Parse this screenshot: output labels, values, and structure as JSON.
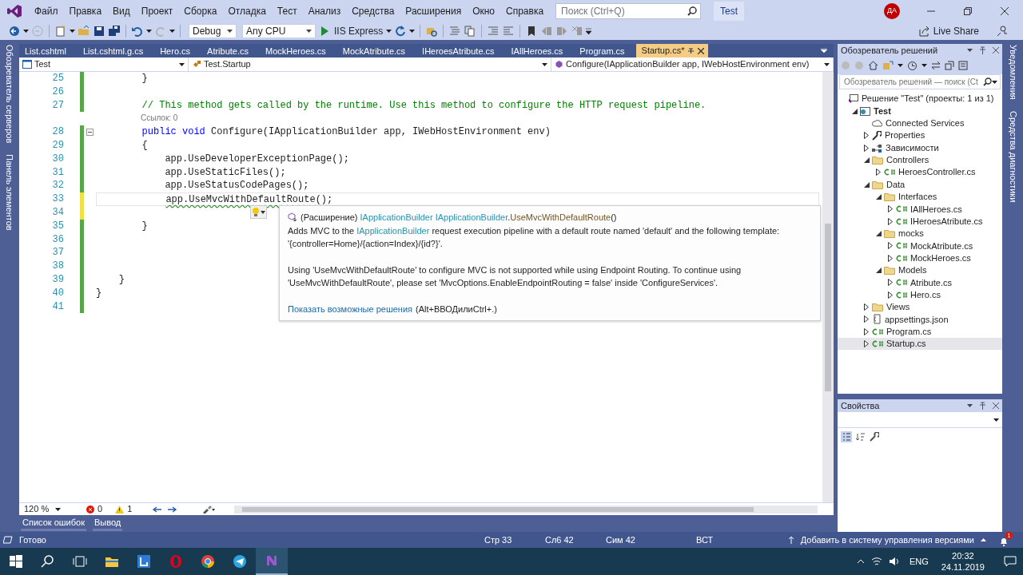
{
  "menu": [
    "Файл",
    "Правка",
    "Вид",
    "Проект",
    "Сборка",
    "Отладка",
    "Тест",
    "Анализ",
    "Средства",
    "Расширения",
    "Окно",
    "Справка"
  ],
  "search": {
    "placeholder": "Поиск (Ctrl+Q)"
  },
  "solution_badge": "Test",
  "avatar": "ДА",
  "toolbar": {
    "configuration": "Debug",
    "platform": "Any CPU",
    "run_target": "IIS Express",
    "live_share": "Live Share"
  },
  "side_left": [
    "Обозреватель серверов",
    "Панель элементов"
  ],
  "side_right": [
    "Уведомления",
    "Средства диагностики"
  ],
  "tabs": [
    {
      "label": "List.cshtml",
      "selected": false
    },
    {
      "label": "List.cshtml.g.cs",
      "selected": false
    },
    {
      "label": "Hero.cs",
      "selected": false
    },
    {
      "label": "Atribute.cs",
      "selected": false
    },
    {
      "label": "MockHeroes.cs",
      "selected": false
    },
    {
      "label": "MockAtribute.cs",
      "selected": false
    },
    {
      "label": "IHeroesAtribute.cs",
      "selected": false
    },
    {
      "label": "IAllHeroes.cs",
      "selected": false
    },
    {
      "label": "Program.cs",
      "selected": false
    },
    {
      "label": "Startup.cs*",
      "selected": true
    }
  ],
  "nav_bar": {
    "project": "Test",
    "class": "Test.Startup",
    "member": "Configure(IApplicationBuilder app, IWebHostEnvironment env)"
  },
  "code": {
    "lines": [
      {
        "kind": "code",
        "number": "25",
        "saved": true,
        "current": false,
        "tokens": [
          {
            "text": "        }",
            "kind": "plain"
          }
        ]
      },
      {
        "kind": "code",
        "number": "26",
        "saved": true,
        "current": false
      },
      {
        "kind": "code",
        "number": "27",
        "saved": true,
        "current": false,
        "tokens": [
          {
            "text": "        // This method gets called by the runtime. Use this method to configure the HTTP request pipeline.",
            "kind": "comment"
          }
        ]
      },
      {
        "kind": "codelens",
        "text": "Ссылок: 0"
      },
      {
        "kind": "code",
        "number": "28",
        "saved": true,
        "current": false,
        "expanded": true,
        "tokens": [
          {
            "text": "        public void",
            "kind": "keyword"
          },
          {
            "text": " Configure(IApplicationBuilder app, IWebHostEnvironment env)",
            "kind": "plain"
          }
        ]
      },
      {
        "kind": "code",
        "number": "29",
        "saved": true,
        "current": false,
        "tokens": [
          {
            "text": "        {",
            "kind": "plain"
          }
        ]
      },
      {
        "kind": "code",
        "number": "30",
        "saved": true,
        "current": false,
        "tokens": [
          {
            "text": "            app.UseDeveloperExceptionPage();",
            "kind": "plain"
          }
        ]
      },
      {
        "kind": "code",
        "number": "31",
        "saved": true,
        "current": false,
        "tokens": [
          {
            "text": "            app.UseStaticFiles();",
            "kind": "plain"
          }
        ]
      },
      {
        "kind": "code",
        "number": "32",
        "saved": true,
        "current": false,
        "tokens": [
          {
            "text": "            app.UseStatusCodePages();",
            "kind": "plain"
          }
        ]
      },
      {
        "kind": "code",
        "number": "33",
        "saved": false,
        "current": true,
        "tokens": [
          {
            "text": "            app.UseMvcWithDefaultRoute()",
            "kind": "warning"
          },
          {
            "text": ";",
            "kind": "plain"
          }
        ]
      },
      {
        "kind": "code",
        "number": "34",
        "saved": false,
        "current": false
      },
      {
        "kind": "code",
        "number": "35",
        "saved": true,
        "current": false,
        "tokens": [
          {
            "text": "        }",
            "kind": "plain"
          }
        ]
      },
      {
        "kind": "code",
        "number": "36",
        "saved": true,
        "current": false
      },
      {
        "kind": "code",
        "number": "37",
        "saved": true,
        "current": false
      },
      {
        "kind": "code",
        "number": "38",
        "saved": true,
        "current": false
      },
      {
        "kind": "code",
        "number": "39",
        "saved": true,
        "current": false,
        "tokens": [
          {
            "text": "    }",
            "kind": "plain"
          }
        ]
      },
      {
        "kind": "code",
        "number": "40",
        "saved": true,
        "current": false,
        "tokens": [
          {
            "text": "}",
            "kind": "plain"
          }
        ]
      },
      {
        "kind": "code",
        "number": "41",
        "saved": true,
        "current": false
      }
    ]
  },
  "quick_info": {
    "signature": [
      {
        "text": "(Расширение) ",
        "kind": "plain"
      },
      {
        "text": "IApplicationBuilder IApplicationBuilder",
        "kind": "type"
      },
      {
        "text": ".",
        "kind": "plain"
      },
      {
        "text": "UseMvcWithDefaultRoute",
        "kind": "method"
      },
      {
        "text": "()",
        "kind": "plain"
      }
    ],
    "summary": [
      {
        "text": "Adds MVC to the ",
        "kind": "plain"
      },
      {
        "text": "IApplicationBuilder",
        "kind": "type"
      },
      {
        "text": " request execution pipeline with a default route named 'default' and the following template: '{controller=Home}/{action=Index}/{id?}'.",
        "kind": "plain"
      }
    ],
    "note": "Using 'UseMvcWithDefaultRoute' to configure MVC is not supported while using Endpoint Routing. To continue using 'UseMvcWithDefaultRoute', please set 'MvcOptions.EnableEndpointRouting = false' inside 'ConfigureServices'.",
    "fix_link": "Показать возможные решения",
    "fix_shortcut": "(Alt+ВВОДилиCtrl+.)"
  },
  "editor_status": {
    "zoom": "120 %",
    "errors": "0",
    "warnings": "1"
  },
  "tool_tabs": [
    "Список ошибок",
    "Вывод"
  ],
  "solution_explorer": {
    "title": "Обозреватель решений",
    "search_placeholder": "Обозреватель решений — поиск (Ct",
    "tree": [
      {
        "label": "Решение \"Test\" (проекты: 1 из 1)",
        "kind": "solution",
        "selected": false,
        "children": [
          {
            "label": "Test",
            "kind": "project",
            "expanded": true,
            "selected": false,
            "children": [
              {
                "label": "Connected Services",
                "kind": "service",
                "selected": false
              },
              {
                "label": "Properties",
                "kind": "properties",
                "expanded": false,
                "selected": false
              },
              {
                "label": "Зависимости",
                "kind": "dependencies",
                "expanded": false,
                "selected": false
              },
              {
                "label": "Controllers",
                "kind": "folder",
                "expanded": true,
                "selected": false,
                "children": [
                  {
                    "label": "HeroesController.cs",
                    "kind": "csharp",
                    "expanded": false,
                    "selected": false
                  }
                ]
              },
              {
                "label": "Data",
                "kind": "folder",
                "expanded": true,
                "selected": false,
                "children": [
                  {
                    "label": "Interfaces",
                    "kind": "folder",
                    "expanded": true,
                    "selected": false,
                    "children": [
                      {
                        "label": "IAllHeroes.cs",
                        "kind": "csharp",
                        "expanded": false,
                        "selected": false
                      },
                      {
                        "label": "IHeroesAtribute.cs",
                        "kind": "csharp",
                        "expanded": false,
                        "selected": false
                      }
                    ]
                  },
                  {
                    "label": "mocks",
                    "kind": "folder",
                    "expanded": true,
                    "selected": false,
                    "children": [
                      {
                        "label": "MockAtribute.cs",
                        "kind": "csharp",
                        "expanded": false,
                        "selected": false
                      },
                      {
                        "label": "MockHeroes.cs",
                        "kind": "csharp",
                        "expanded": false,
                        "selected": false
                      }
                    ]
                  },
                  {
                    "label": "Models",
                    "kind": "folder",
                    "expanded": true,
                    "selected": false,
                    "children": [
                      {
                        "label": "Atribute.cs",
                        "kind": "csharp",
                        "expanded": false,
                        "selected": false
                      },
                      {
                        "label": "Hero.cs",
                        "kind": "csharp",
                        "expanded": false,
                        "selected": false
                      }
                    ]
                  }
                ]
              },
              {
                "label": "Views",
                "kind": "folder",
                "expanded": false,
                "selected": false
              },
              {
                "label": "appsettings.json",
                "kind": "json",
                "expanded": false,
                "selected": false
              },
              {
                "label": "Program.cs",
                "kind": "csharp",
                "expanded": false,
                "selected": false
              },
              {
                "label": "Startup.cs",
                "kind": "csharp",
                "expanded": false,
                "selected": true
              }
            ]
          }
        ]
      }
    ]
  },
  "properties": {
    "title": "Свойства"
  },
  "status_bar": {
    "state": "Готово",
    "line": "Стр 33",
    "column": "Сл6 42",
    "char": "Сим 42",
    "mode": "ВСТ",
    "source_control": "Добавить в систему управления версиями",
    "notifications": "1"
  },
  "taskbar": {
    "language": "ENG",
    "time": "20:32",
    "date": "24.11.2019"
  }
}
